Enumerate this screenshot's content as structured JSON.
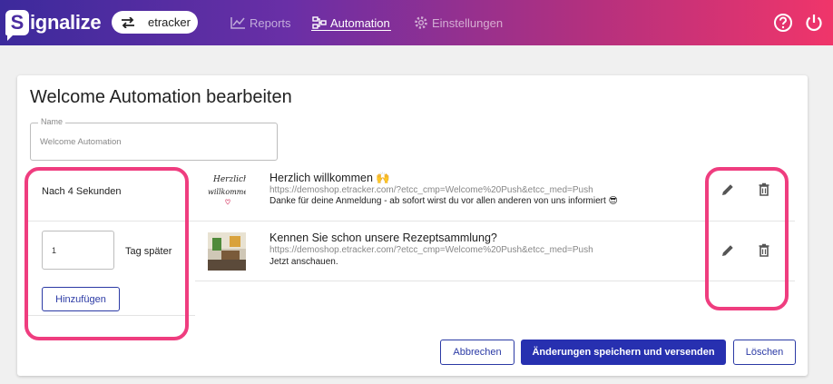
{
  "brand": {
    "logo_letter": "S",
    "logo_text": "ignalize"
  },
  "account": {
    "name": "etracker"
  },
  "nav": [
    {
      "label": "Reports"
    },
    {
      "label": "Automation"
    },
    {
      "label": "Einstellungen"
    }
  ],
  "page": {
    "title": "Welcome Automation bearbeiten",
    "name_label": "Name",
    "name_value": "Welcome Automation"
  },
  "steps": {
    "delay_text": "Nach 4 Sekunden",
    "interval_value": "1",
    "interval_unit": "Tag später",
    "add_label": "Hinzufügen"
  },
  "messages": [
    {
      "title": "Herzlich willkommen 🙌",
      "url": "https://demoshop.etracker.com/?etcc_cmp=Welcome%20Push&etcc_med=Push",
      "body": "Danke für deine Anmeldung - ab sofort wirst du vor allen anderen von uns informiert 😎",
      "thumb_text_1": "Herzlich",
      "thumb_text_2": "willkommen"
    },
    {
      "title": "Kennen Sie schon unsere Rezeptsammlung?",
      "url": "https://demoshop.etracker.com/?etcc_cmp=Welcome%20Push&etcc_med=Push",
      "body": "Jetzt anschauen."
    }
  ],
  "actions": {
    "cancel": "Abbrechen",
    "save": "Änderungen speichern und versenden",
    "delete": "Löschen"
  },
  "colors": {
    "primary": "#2730b0",
    "highlight": "#ef3d7f"
  },
  "icons": [
    "swap-icon",
    "chart-icon",
    "sitemap-icon",
    "gear-icon",
    "help-icon",
    "power-icon",
    "pencil-icon",
    "trash-icon"
  ]
}
